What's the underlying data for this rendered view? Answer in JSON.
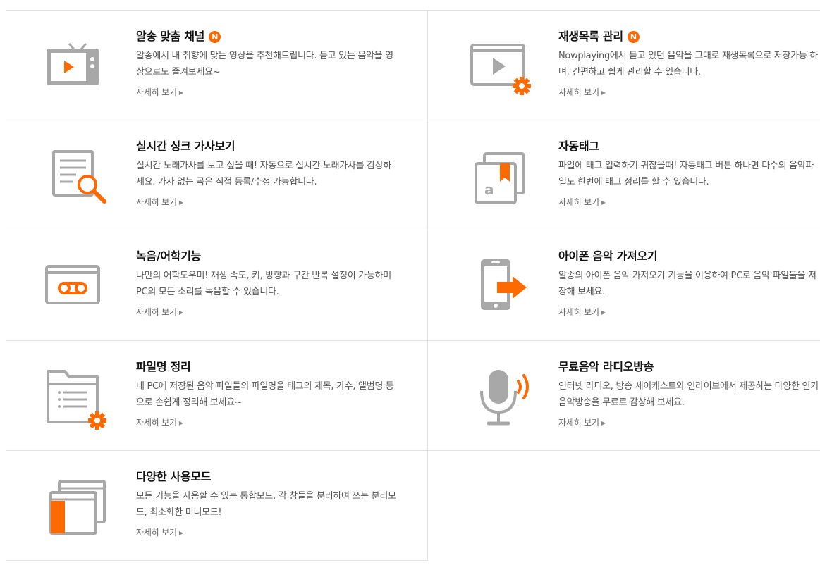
{
  "colors": {
    "accent": "#ff6a00",
    "icon_gray": "#a8a8a8",
    "border": "#e2e2e2"
  },
  "features": [
    {
      "title": "알송 맞춤 채널",
      "badge": "N",
      "desc": "알송에서 내 취향에 맞는 영상을 추천해드립니다. 듣고 있는 음악을 영상으로도 즐겨보세요~",
      "more": "자세히 보기",
      "icon": "tv-play-icon"
    },
    {
      "title": "재생목록 관리",
      "badge": "N",
      "desc": "Nowplaying에서 듣고 있던 음악을 그대로 재생목록으로 저장가능 하며, 간편하고 쉽게 관리할 수 있습니다.",
      "more": "자세히 보기",
      "icon": "playlist-gear-icon"
    },
    {
      "title": "실시간 싱크 가사보기",
      "badge": "",
      "desc": "실시간 노래가사를 보고 싶을 때! 자동으로 실시간 노래가사를 감상하세요. 가사 없는 곡은 직접 등록/수정 가능합니다.",
      "more": "자세히 보기",
      "icon": "lyrics-search-icon"
    },
    {
      "title": "자동태그",
      "badge": "",
      "desc": "파일에 태그 입력하기 귀찮을때! 자동태그 버튼 하나면 다수의 음악파일도 한번에 태그 정리를 할 수 있습니다.",
      "more": "자세히 보기",
      "icon": "auto-tag-icon"
    },
    {
      "title": "녹음/어학기능",
      "badge": "",
      "desc": "나만의 어학도우미! 재생 속도, 키, 방향과 구간 반복 설정이 가능하며 PC의 모든 소리를 녹음할 수 있습니다.",
      "more": "자세히 보기",
      "icon": "cassette-icon"
    },
    {
      "title": "아이폰 음악 가져오기",
      "badge": "",
      "desc": "알송의 아이폰 음악 가져오기 기능을 이용하여 PC로 음악 파일들을 저장해 보세요.",
      "more": "자세히 보기",
      "icon": "phone-transfer-icon"
    },
    {
      "title": "파일명 정리",
      "badge": "",
      "desc": "내 PC에 저장된 음악 파일들의 파일명을 태그의 제목, 가수, 앨범명 등으로 손쉽게 정리해 보세요~",
      "more": "자세히 보기",
      "icon": "folder-gear-icon"
    },
    {
      "title": "무료음악 라디오방송",
      "badge": "",
      "desc": "인터넷 라디오, 방송 세이캐스트와 인라이브에서 제공하는 다양한 인기 음악방송을 무료로 감상해 보세요.",
      "more": "자세히 보기",
      "icon": "microphone-icon"
    },
    {
      "title": "다양한 사용모드",
      "badge": "",
      "desc": "모든 기능을 사용할 수 있는 통합모드, 각 창들을 분리하여 쓰는 분리모드, 최소화한 미니모드!",
      "more": "자세히 보기",
      "icon": "windows-mode-icon"
    }
  ]
}
